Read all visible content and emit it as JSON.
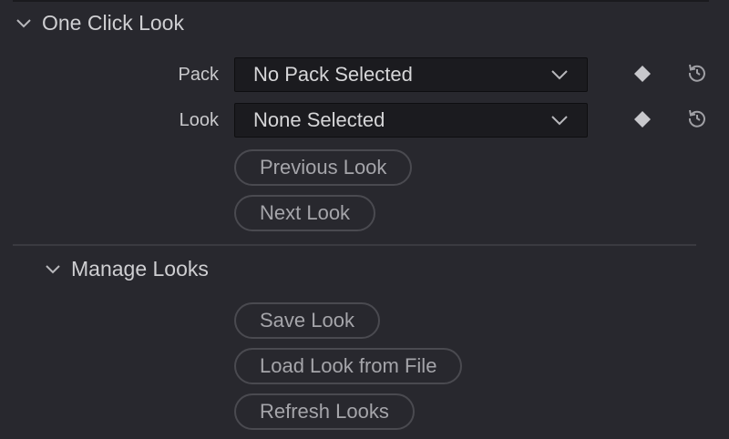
{
  "one_click_look": {
    "title": "One Click Look",
    "pack": {
      "label": "Pack",
      "value": "No Pack Selected"
    },
    "look": {
      "label": "Look",
      "value": "None Selected"
    },
    "previous_label": "Previous Look",
    "next_label": "Next Look"
  },
  "manage_looks": {
    "title": "Manage Looks",
    "save_label": "Save Look",
    "load_label": "Load Look from File",
    "refresh_label": "Refresh Looks"
  },
  "colors": {
    "background": "#28282e",
    "dropdown_bg": "#1b1b1f",
    "button_border": "#4a4a50",
    "text": "#c9c9cc"
  }
}
